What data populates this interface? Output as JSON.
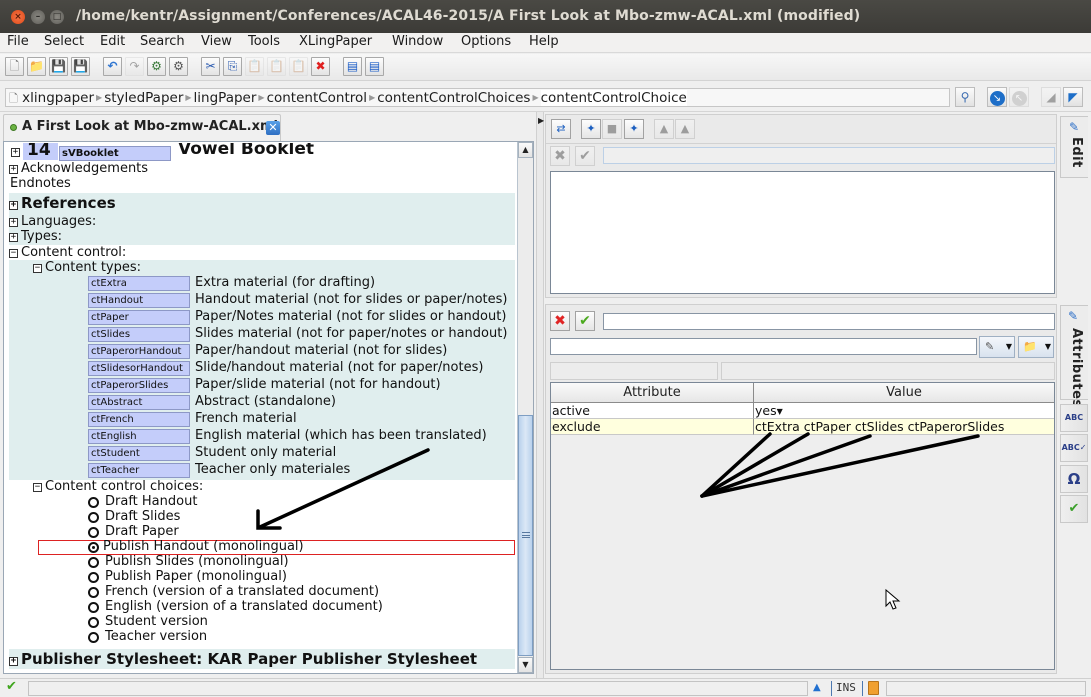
{
  "window": {
    "title": "/home/kentr/Assignment/Conferences/ACAL46-2015/A First Look at Mbo-zmw-ACAL.xml (modified)",
    "controls": [
      "close",
      "minimize",
      "maximize"
    ]
  },
  "menu": [
    {
      "label": "File",
      "mnemonic": "F"
    },
    {
      "label": "Select",
      "mnemonic": "l"
    },
    {
      "label": "Edit",
      "mnemonic": "E"
    },
    {
      "label": "Search",
      "mnemonic": "S"
    },
    {
      "label": "View",
      "mnemonic": "V"
    },
    {
      "label": "Tools",
      "mnemonic": "T"
    },
    {
      "label": "XLingPaper",
      "mnemonic": "X"
    },
    {
      "label": "Window",
      "mnemonic": "W"
    },
    {
      "label": "Options",
      "mnemonic": "O"
    },
    {
      "label": "Help",
      "mnemonic": "H"
    }
  ],
  "toolbar": {
    "icons": [
      "new-document-icon",
      "open-folder-icon",
      "save-icon",
      "save-all-icon",
      "undo-icon",
      "redo-icon",
      "validate-transform-icon",
      "validate-icon",
      "cut-icon",
      "copy-icon",
      "paste-icon",
      "paste-special-icon",
      "paste-after-icon",
      "delete-icon",
      "split-view-icon",
      "add-view-icon"
    ],
    "glyphs": [
      "🗋",
      "📁",
      "💾",
      "💾",
      "↶",
      "↷",
      "⚙",
      "⚙",
      "✂",
      "⎘",
      "📋",
      "📋",
      "📋",
      "✖",
      "▤",
      "▤"
    ]
  },
  "breadcrumb": {
    "items": [
      "xlingpaper",
      "styledPaper",
      "lingPaper",
      "contentControl",
      "contentControlChoices",
      "contentControlChoice"
    ],
    "page_icon": "🗋"
  },
  "document_tab": {
    "label": "A First Look at Mbo-zmw-ACAL.xml",
    "close": "✕"
  },
  "tree": {
    "section14": {
      "number": "14",
      "tag": "sVBooklet",
      "title": "Vowel Booklet"
    },
    "acknowledgements": "Acknowledgements",
    "endnotes": "Endnotes",
    "references": "References",
    "languages": "Languages:",
    "types": "Types:",
    "content_control": "Content control:",
    "content_types_label": "Content types:",
    "content_types": [
      {
        "tag": "ctExtra",
        "desc": "Extra material (for drafting)"
      },
      {
        "tag": "ctHandout",
        "desc": "Handout material (not for slides or paper/notes)"
      },
      {
        "tag": "ctPaper",
        "desc": "Paper/Notes material (not for slides or handout)"
      },
      {
        "tag": "ctSlides",
        "desc": "Slides material (not for paper/notes or handout)"
      },
      {
        "tag": "ctPaperorHandout",
        "desc": "Paper/handout material (not for slides)"
      },
      {
        "tag": "ctSlidesorHandout",
        "desc": "Slide/handout material (not for paper/notes)"
      },
      {
        "tag": "ctPaperorSlides",
        "desc": "Paper/slide material (not for handout)"
      },
      {
        "tag": "ctAbstract",
        "desc": "Abstract (standalone)"
      },
      {
        "tag": "ctFrench",
        "desc": "French material"
      },
      {
        "tag": "ctEnglish",
        "desc": "English material (which has been translated)"
      },
      {
        "tag": "ctStudent",
        "desc": "Student only material"
      },
      {
        "tag": "ctTeacher",
        "desc": "Teacher only materiales"
      }
    ],
    "choices_label": "Content control choices:",
    "choices": [
      {
        "label": "Draft Handout",
        "selected": false
      },
      {
        "label": "Draft Slides",
        "selected": false
      },
      {
        "label": "Draft Paper",
        "selected": false
      },
      {
        "label": "Publish Handout (monolingual)",
        "selected": true
      },
      {
        "label": "Publish Slides (monolingual)",
        "selected": false
      },
      {
        "label": "Publish Paper (monolingual)",
        "selected": false
      },
      {
        "label": "French (version of a translated document)",
        "selected": false
      },
      {
        "label": "English (version of a translated document)",
        "selected": false
      },
      {
        "label": "Student version",
        "selected": false
      },
      {
        "label": "Teacher version",
        "selected": false
      }
    ],
    "publisher_stylesheet": "Publisher Stylesheet: KAR Paper Publisher Stylesheet",
    "toggle_plus": "+",
    "toggle_minus": "−"
  },
  "edit_panel": {
    "tab_label": "Edit",
    "input_value": "",
    "text_value": ""
  },
  "attributes_panel": {
    "tab_label": "Attributes",
    "input_value": "",
    "name_value": "",
    "columns": [
      "Attribute",
      "Value"
    ],
    "rows": [
      {
        "attribute": "active",
        "value": "yes",
        "dropdown": true,
        "highlight": false
      },
      {
        "attribute": "exclude",
        "value": "ctExtra ctPaper ctSlides ctPaperorSlides",
        "dropdown": false,
        "highlight": true
      }
    ]
  },
  "side_buttons": [
    {
      "name": "find-spell-icon",
      "glyph": "ABC"
    },
    {
      "name": "spellcheck-icon",
      "glyph": "ABC✓"
    },
    {
      "name": "special-chars-icon",
      "glyph": "Ω"
    },
    {
      "name": "validation-icon",
      "glyph": "✔"
    }
  ],
  "status": {
    "valid_glyph": "✔",
    "mode": "INS"
  },
  "colors": {
    "tag_bg": "#c4cdfa",
    "teal_bg": "#e0eeee",
    "selection_border": "#dd2222",
    "highlight_row": "#ffffde"
  }
}
